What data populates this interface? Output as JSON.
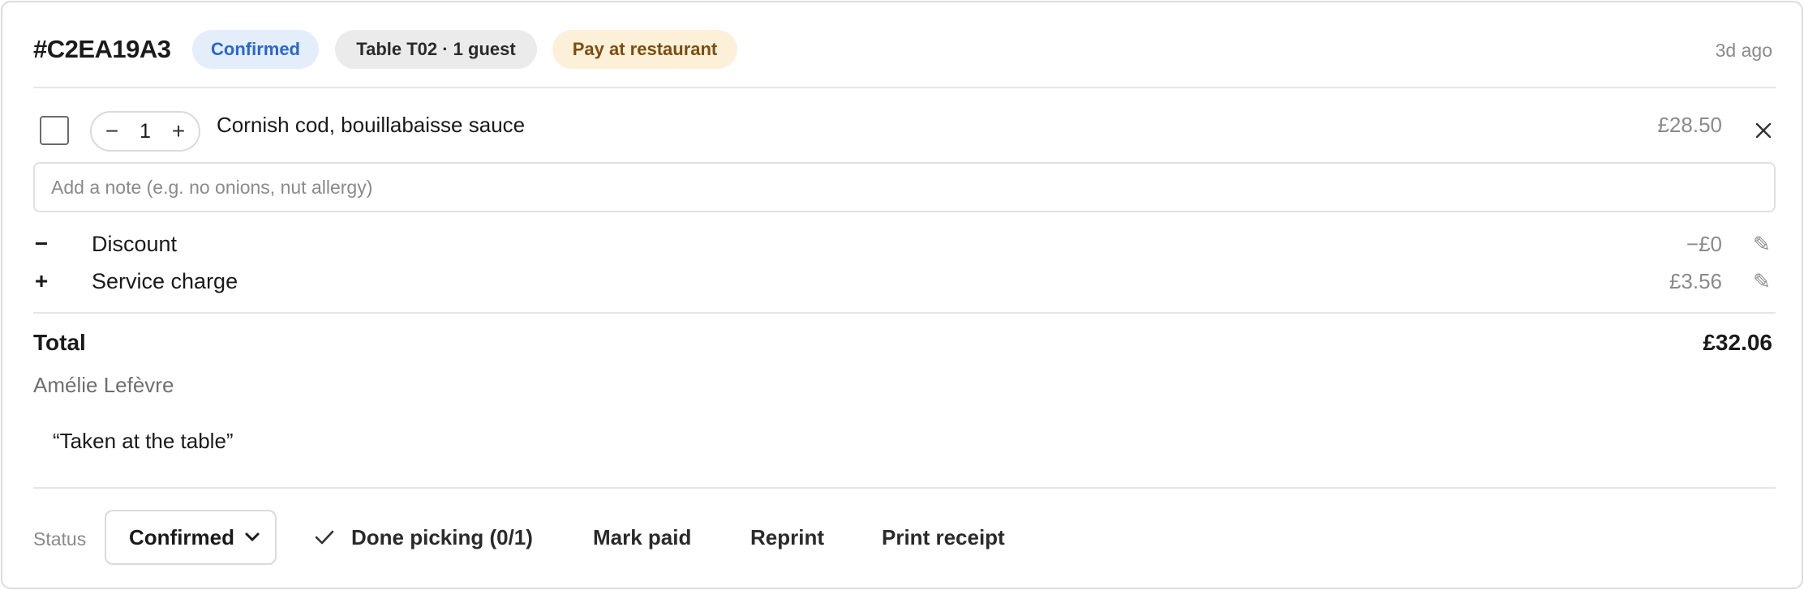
{
  "order": {
    "id": "#C2EA19A3",
    "status_badge": "Confirmed",
    "table_badge": "Table T02 · 1 guest",
    "payment_badge": "Pay at restaurant",
    "time_ago": "3d ago"
  },
  "item": {
    "name": "Cornish cod, bouillabaisse sauce",
    "quantity": "1",
    "minus": "−",
    "plus": "+",
    "price": "£28.50",
    "checked": false
  },
  "note": {
    "placeholder": "Add a note (e.g. no onions, nut allergy)",
    "value": ""
  },
  "adjustments": [
    {
      "sign": "−",
      "label": "Discount",
      "value": "−£0",
      "edit_icon": "pencil-icon"
    },
    {
      "sign": "+",
      "label": "Service charge",
      "value": "£3.56",
      "edit_icon": "pencil-icon"
    }
  ],
  "total": {
    "label": "Total",
    "value": "£32.06"
  },
  "customer": {
    "name": "Amélie Lefèvre",
    "note": "“Taken at the table”"
  },
  "footer": {
    "status_label": "Status",
    "status_value": "Confirmed",
    "status_options": [
      "Confirmed"
    ],
    "done_picking": "Done picking (0/1)",
    "mark_paid": "Mark paid",
    "reprint": "Reprint",
    "print_receipt": "Print receipt"
  },
  "colors": {
    "confirmed_bg": "#e4eefb",
    "confirmed_text": "#2b67c9",
    "table_bg": "#ebebeb",
    "pay_bg": "#fdf0d9",
    "pay_text": "#7a4e10",
    "muted_text": "#8a8a8a",
    "border": "#dcdcdc"
  }
}
